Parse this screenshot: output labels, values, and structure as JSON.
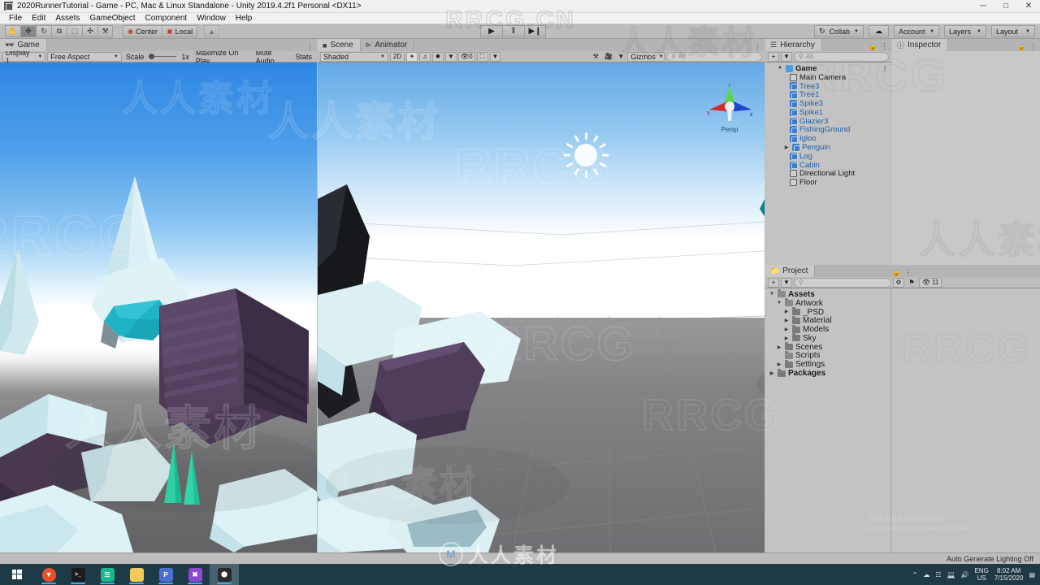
{
  "window": {
    "title": "2020RunnerTutorial - Game - PC, Mac & Linux Standalone - Unity 2019.4.2f1 Personal <DX11>",
    "minimize": "─",
    "maximize": "□",
    "close": "✕"
  },
  "menubar": {
    "items": [
      "File",
      "Edit",
      "Assets",
      "GameObject",
      "Component",
      "Window",
      "Help"
    ]
  },
  "toolbar": {
    "tools": [
      {
        "name": "hand-tool",
        "glyph": "✋",
        "active": false
      },
      {
        "name": "move-tool",
        "glyph": "✥",
        "active": true
      },
      {
        "name": "rotate-tool",
        "glyph": "↻",
        "active": false
      },
      {
        "name": "scale-tool",
        "glyph": "⧉",
        "active": false
      },
      {
        "name": "rect-tool",
        "glyph": "⬚",
        "active": false
      },
      {
        "name": "transform-tool",
        "glyph": "✣",
        "active": false
      },
      {
        "name": "custom-tool",
        "glyph": "⚒",
        "active": false
      }
    ],
    "pivot_label": "Center",
    "space_label": "Local",
    "collab_label": "Collab",
    "cloud_label": "☁",
    "account_label": "Account",
    "layers_label": "Layers",
    "layout_label": "Layout",
    "play_glyph": "▶",
    "pause_glyph": "‖",
    "step_glyph": "▶❙"
  },
  "game_panel": {
    "tab_label": "Game",
    "display_label": "Display 1",
    "aspect_label": "Free Aspect",
    "scale_label": "Scale",
    "scale_value": "1x",
    "maximize_label": "Maximize On Play",
    "mute_label": "Mute Audio",
    "stats_label": "Stats"
  },
  "scene_panel": {
    "tabs": [
      {
        "label": "Scene",
        "active": true
      },
      {
        "label": "Animator",
        "active": false
      }
    ],
    "shading_label": "Shaded",
    "mode_2d_label": "2D",
    "light_glyph": "☀",
    "audio_glyph": "♫",
    "fx_glyph": "✹",
    "hidden_count": "0",
    "gizmos_label": "Gizmos",
    "search_placeholder": "All",
    "gizmo_persp_label": "Persp",
    "gizmo_axes": [
      "x",
      "y",
      "z"
    ]
  },
  "hierarchy": {
    "tab_label": "Hierarchy",
    "search_placeholder": "All",
    "create_label": "+",
    "items": [
      {
        "label": "Game",
        "depth": 0,
        "icon": "scene-icon",
        "bold": true,
        "expanded": true
      },
      {
        "label": "Main Camera",
        "depth": 1,
        "icon": "camera-icon"
      },
      {
        "label": "Tree3",
        "depth": 1,
        "icon": "prefab-icon"
      },
      {
        "label": "Tree1",
        "depth": 1,
        "icon": "prefab-icon"
      },
      {
        "label": "Spike3",
        "depth": 1,
        "icon": "prefab-icon"
      },
      {
        "label": "Spike1",
        "depth": 1,
        "icon": "prefab-icon"
      },
      {
        "label": "Glazier3",
        "depth": 1,
        "icon": "prefab-icon"
      },
      {
        "label": "FishingGround",
        "depth": 1,
        "icon": "prefab-icon"
      },
      {
        "label": "Igloo",
        "depth": 1,
        "icon": "prefab-icon"
      },
      {
        "label": "Penguin",
        "depth": 1,
        "icon": "prefab-icon",
        "expandable": true
      },
      {
        "label": "Log",
        "depth": 1,
        "icon": "prefab-icon"
      },
      {
        "label": "Cabin",
        "depth": 1,
        "icon": "prefab-icon"
      },
      {
        "label": "Directional Light",
        "depth": 1,
        "icon": "light-icon"
      },
      {
        "label": "Floor",
        "depth": 1,
        "icon": "light-icon"
      }
    ]
  },
  "inspector": {
    "tab_label": "Inspector"
  },
  "project": {
    "tab_label": "Project",
    "create_label": "+",
    "search_placeholder": "",
    "count_label": "11",
    "items": [
      {
        "label": "Assets",
        "depth": 0,
        "bold": true,
        "expanded": true
      },
      {
        "label": "Artwork",
        "depth": 1,
        "expanded": true
      },
      {
        "label": "_PSD",
        "depth": 2,
        "expandable": true
      },
      {
        "label": "Material",
        "depth": 2,
        "expandable": true
      },
      {
        "label": "Models",
        "depth": 2,
        "expandable": true
      },
      {
        "label": "Sky",
        "depth": 2,
        "expandable": true
      },
      {
        "label": "Scenes",
        "depth": 1,
        "expandable": true
      },
      {
        "label": "Scripts",
        "depth": 1
      },
      {
        "label": "Settings",
        "depth": 1,
        "expandable": true
      },
      {
        "label": "Packages",
        "depth": 0,
        "bold": true,
        "expandable": true
      }
    ]
  },
  "statusbar": {
    "message": "Auto Generate Lighting Off"
  },
  "taskbar": {
    "items": [
      {
        "name": "start-button",
        "glyph": "",
        "color": ""
      },
      {
        "name": "brave-browser-icon",
        "glyph": "▼",
        "color": "#e8502a"
      },
      {
        "name": "terminal-icon",
        "glyph": ">_",
        "color": "#1c1c1c"
      },
      {
        "name": "chat-app-icon",
        "glyph": "⌨",
        "color": "#16b98a"
      },
      {
        "name": "file-explorer-icon",
        "glyph": "",
        "color": "#f3c95a"
      },
      {
        "name": "presentation-icon",
        "glyph": "P",
        "color": "#4a6fd0"
      },
      {
        "name": "visual-studio-code-icon",
        "glyph": "✕",
        "color": "#8b4ad0"
      },
      {
        "name": "unity-editor-icon",
        "glyph": "⬢",
        "color": "#2a2a2a"
      }
    ],
    "tray": {
      "chevron": "⌃",
      "language": "ENG",
      "region": "US",
      "time": "8:02 AM",
      "date": "7/15/2020",
      "notification_glyph": "▤"
    }
  },
  "watermarks": {
    "brand": "RRCG",
    "site": "RRCG.CN",
    "chinese": "人人素材",
    "logo_text": "M"
  },
  "activate_windows": {
    "line1": "Activate Windows",
    "line2": "Go to Settings to activate Windows."
  },
  "colors": {
    "sky_top": "#2f86e3",
    "ice_light": "#d6eff3",
    "ice_teal": "#1fb8c8",
    "wood_purple": "#4c3b57",
    "spike_green": "#2fe0b0",
    "floor_gray": "#7a7a7d",
    "unity_chrome": "#bdbdbd",
    "taskbar": "#1f3a47",
    "selection_blue": "#4a75b5"
  }
}
